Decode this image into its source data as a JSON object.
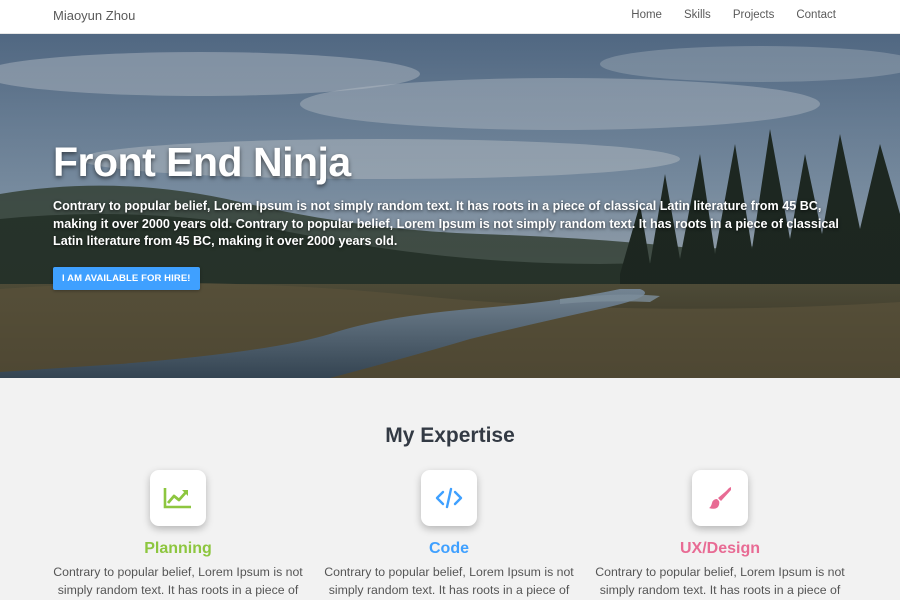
{
  "nav": {
    "brand": "Miaoyun Zhou",
    "links": [
      "Home",
      "Skills",
      "Projects",
      "Contact"
    ]
  },
  "hero": {
    "title": "Front End Ninja",
    "text": "Contrary to popular belief, Lorem Ipsum is not simply random text. It has roots in a piece of classical Latin literature from 45 BC, making it over 2000 years old. Contrary to popular belief, Lorem Ipsum is not simply random text. It has roots in a piece of classical Latin literature from 45 BC, making it over 2000 years old.",
    "button_label": "I AM AVAILABLE FOR HIRE!"
  },
  "expertise": {
    "title": "My Expertise",
    "cards": [
      {
        "title": "Planning",
        "icon": "chart-line-icon",
        "color": "#8dc63f",
        "text": "Contrary to popular belief, Lorem Ipsum is not simply random text. It has roots in a piece of"
      },
      {
        "title": "Code",
        "icon": "code-icon",
        "color": "#3fa0ff",
        "text": "Contrary to popular belief, Lorem Ipsum is not simply random text. It has roots in a piece of"
      },
      {
        "title": "UX/Design",
        "icon": "paintbrush-icon",
        "color": "#e86b94",
        "text": "Contrary to popular belief, Lorem Ipsum is not simply random text. It has roots in a piece of"
      }
    ]
  },
  "colors": {
    "accent": "#3fa0ff",
    "background": "#f2f2f2"
  }
}
